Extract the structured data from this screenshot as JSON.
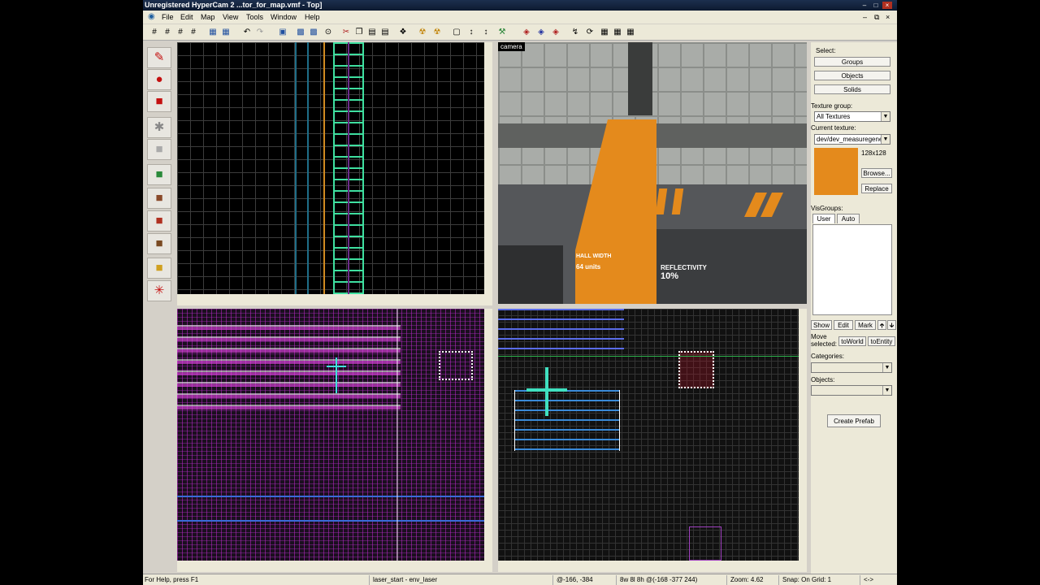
{
  "window": {
    "title": "Unregistered HyperCam 2 ...tor_for_map.vmf - Top]"
  },
  "menu": {
    "items": [
      "File",
      "Edit",
      "Map",
      "View",
      "Tools",
      "Window",
      "Help"
    ]
  },
  "viewports": {
    "camera_label": "camera",
    "texture_text_1": "HALL WIDTH",
    "texture_text_2": "64 units",
    "texture_text_3": "REFLECTIVITY",
    "texture_text_4": "10%"
  },
  "panel": {
    "select_label": "Select:",
    "groups": "Groups",
    "objects": "Objects",
    "solids": "Solids",
    "texture_group_label": "Texture group:",
    "texture_group_value": "All Textures",
    "current_texture_label": "Current texture:",
    "current_texture_value": "dev/dev_measuregene",
    "texture_size": "128x128",
    "browse": "Browse...",
    "replace": "Replace",
    "visgroups_label": "VisGroups:",
    "tab_user": "User",
    "tab_auto": "Auto",
    "show": "Show",
    "edit": "Edit",
    "mark": "Mark",
    "move_selected": "Move selected:",
    "to_world": "toWorld",
    "to_entity": "toEntity",
    "categories_label": "Categories:",
    "objects_label": "Objects:",
    "create_prefab": "Create Prefab"
  },
  "status": {
    "help": "For Help, press F1",
    "selection": "laser_start - env_laser",
    "coords": "@-166, -384",
    "size": "8w 8l 8h @(-168 -377 244)",
    "zoom": "Zoom: 4.62",
    "snap": "Snap: On Grid: 1"
  },
  "colors": {
    "accent": "#e48a1c",
    "title_bg": "#0d1a30",
    "panel_bg": "#ece9d8"
  }
}
